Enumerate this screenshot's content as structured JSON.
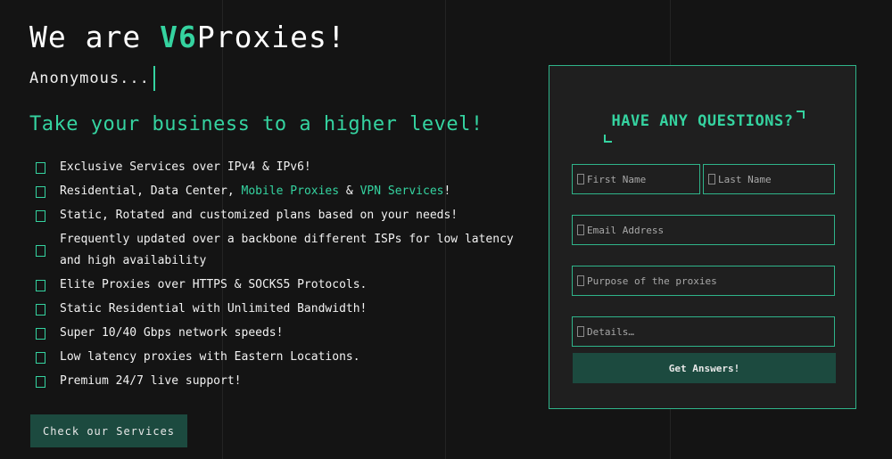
{
  "hero": {
    "prefix": "We are ",
    "brand": "V6",
    "suffix": "Proxies!",
    "typing_text": "Anonymous..."
  },
  "tagline": "Take your business to a higher level!",
  "features": [
    {
      "segments": [
        {
          "text": "Exclusive Services over IPv4 & IPv6!",
          "highlight": false
        }
      ]
    },
    {
      "segments": [
        {
          "text": "Residential, Data Center, ",
          "highlight": false
        },
        {
          "text": "Mobile Proxies",
          "highlight": true
        },
        {
          "text": " & ",
          "highlight": false
        },
        {
          "text": "VPN Services",
          "highlight": true
        },
        {
          "text": "!",
          "highlight": false
        }
      ]
    },
    {
      "segments": [
        {
          "text": "Static, Rotated and customized plans based on your needs!",
          "highlight": false
        }
      ]
    },
    {
      "segments": [
        {
          "text": "Frequently updated over a backbone different ISPs for low latency and high availability",
          "highlight": false
        }
      ]
    },
    {
      "segments": [
        {
          "text": "Elite Proxies over HTTPS & SOCKS5 Protocols.",
          "highlight": false
        }
      ]
    },
    {
      "segments": [
        {
          "text": "Static Residential with Unlimited Bandwidth!",
          "highlight": false
        }
      ]
    },
    {
      "segments": [
        {
          "text": "Super 10/40 Gbps network speeds!",
          "highlight": false
        }
      ]
    },
    {
      "segments": [
        {
          "text": "Low latency proxies with Eastern Locations.",
          "highlight": false
        }
      ]
    },
    {
      "segments": [
        {
          "text": "Premium 24/7 live support!",
          "highlight": false
        }
      ]
    }
  ],
  "cta_label": "Check our Services",
  "form": {
    "heading": "HAVE ANY QUESTIONS?",
    "first_name_placeholder": "First Name",
    "last_name_placeholder": "Last Name",
    "email_placeholder": "Email Address",
    "purpose_placeholder": "Purpose of the proxies",
    "details_placeholder": "Details…",
    "submit_label": "Get Answers!"
  },
  "colors": {
    "background": "#141414",
    "accent": "#35d3a0",
    "button": "#1c4a3f",
    "card": "#1f1f1f"
  }
}
